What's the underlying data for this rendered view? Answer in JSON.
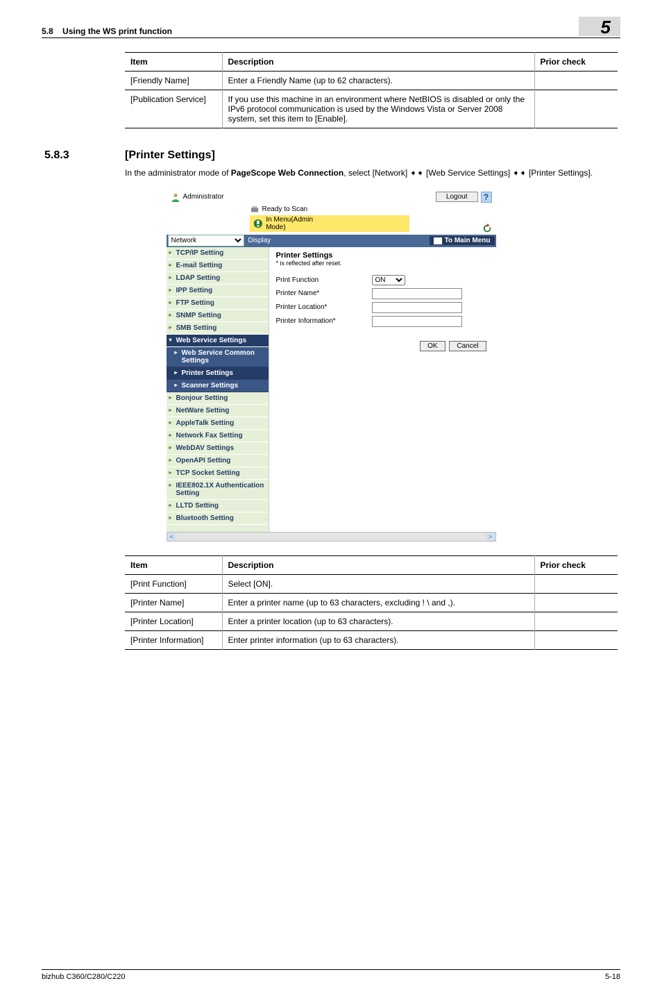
{
  "runhead": {
    "section": "5.8",
    "title": "Using the WS print function",
    "chapter": "5"
  },
  "table1": {
    "headers": {
      "item": "Item",
      "desc": "Description",
      "prior": "Prior check"
    },
    "rows": [
      {
        "item": "[Friendly Name]",
        "desc": "Enter a Friendly Name (up to 62 characters).",
        "prior": ""
      },
      {
        "item": "[Publication Service]",
        "desc": "If you use this machine in an environment where NetBIOS is disabled or only the IPv6 protocol communication is used by the Windows Vista or Server 2008 system, set this item to [Enable].",
        "prior": ""
      }
    ]
  },
  "section": {
    "num": "5.8.3",
    "title": "[Printer Settings]"
  },
  "bodytext": {
    "pre": "In the administrator mode of ",
    "bold": "PageScope Web Connection",
    "post": ", select [Network] ➧➧ [Web Service Settings] ➧➧ [Printer Settings]."
  },
  "shot": {
    "administrator": "Administrator",
    "logout": "Logout",
    "help": "?",
    "ready": "Ready to Scan",
    "admin_mode": "In Menu(Admin Mode)",
    "nav_select": "Network",
    "display": "Display",
    "to_main": "To Main Menu",
    "sidebar": {
      "tcpip": "TCP/IP Setting",
      "email": "E-mail Setting",
      "ldap": "LDAP Setting",
      "ipp": "IPP Setting",
      "ftp": "FTP Setting",
      "snmp": "SNMP Setting",
      "smb": "SMB Setting",
      "webservice": "Web Service Settings",
      "ws_common": "Web Service Common Settings",
      "ws_printer": "Printer Settings",
      "ws_scanner": "Scanner Settings",
      "bonjour": "Bonjour Setting",
      "netware": "NetWare Setting",
      "appletalk": "AppleTalk Setting",
      "netfax": "Network Fax Setting",
      "webdav": "WebDAV Settings",
      "openapi": "OpenAPI Setting",
      "tcpsocket": "TCP Socket Setting",
      "ieee": "IEEE802.1X Authentication Setting",
      "lltd": "LLTD Setting",
      "bluetooth": "Bluetooth Setting"
    },
    "content": {
      "title": "Printer Settings",
      "note": "* is reflected after reset.",
      "print_function": "Print Function",
      "print_function_val": "ON",
      "printer_name": "Printer Name*",
      "printer_location": "Printer Location*",
      "printer_info": "Printer Information*",
      "ok": "OK",
      "cancel": "Cancel"
    }
  },
  "table2": {
    "headers": {
      "item": "Item",
      "desc": "Description",
      "prior": "Prior check"
    },
    "rows": [
      {
        "item": "[Print Function]",
        "desc": "Select [ON].",
        "prior": ""
      },
      {
        "item": "[Printer Name]",
        "desc": "Enter a printer name (up to 63 characters, excluding ! \\ and ,).",
        "prior": ""
      },
      {
        "item": "[Printer Location]",
        "desc": "Enter a printer location (up to 63 characters).",
        "prior": ""
      },
      {
        "item": "[Printer Information]",
        "desc": "Enter printer information (up to 63 characters).",
        "prior": ""
      }
    ]
  },
  "footer": {
    "left": "bizhub C360/C280/C220",
    "right": "5-18"
  }
}
